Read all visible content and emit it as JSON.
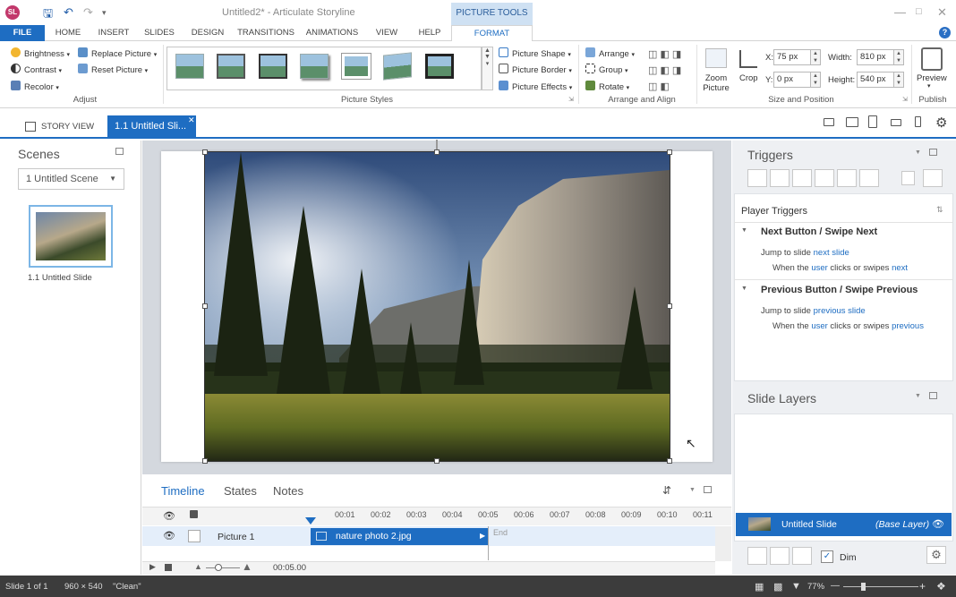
{
  "app": {
    "logo": "SL",
    "title": "Untitled2* - Articulate Storyline",
    "context_tab_header": "PICTURE TOOLS"
  },
  "ribbon_tabs": [
    "FILE",
    "HOME",
    "INSERT",
    "SLIDES",
    "DESIGN",
    "TRANSITIONS",
    "ANIMATIONS",
    "VIEW",
    "HELP",
    "FORMAT"
  ],
  "ribbon": {
    "adjust": {
      "label": "Adjust",
      "brightness": "Brightness",
      "contrast": "Contrast",
      "recolor": "Recolor",
      "replace_picture": "Replace Picture",
      "reset_picture": "Reset Picture"
    },
    "picture_styles": {
      "label": "Picture Styles",
      "shape": "Picture Shape",
      "border": "Picture Border",
      "effects": "Picture Effects"
    },
    "arrange": {
      "label": "Arrange and Align",
      "arrange": "Arrange",
      "group": "Group",
      "rotate": "Rotate"
    },
    "zoom_picture": "Zoom Picture",
    "crop": "Crop",
    "size_position": {
      "label": "Size and Position",
      "x_label": "X:",
      "x_value": "75 px",
      "y_label": "Y:",
      "y_value": "0 px",
      "width_label": "Width:",
      "width_value": "810 px",
      "height_label": "Height:",
      "height_value": "540 px"
    },
    "publish": {
      "label": "Publish",
      "preview": "Preview"
    }
  },
  "view_bar": {
    "story_view": "STORY VIEW",
    "slide_tab": "1.1 Untitled Sli...",
    "close": "✕"
  },
  "scenes": {
    "title": "Scenes",
    "selected_scene": "1 Untitled Scene",
    "slide_label": "1.1 Untitled Slide"
  },
  "timeline": {
    "tabs": [
      "Timeline",
      "States",
      "Notes"
    ],
    "ticks": [
      "00:01",
      "00:02",
      "00:03",
      "00:04",
      "00:05",
      "00:06",
      "00:07",
      "00:08",
      "00:09",
      "00:10",
      "00:11"
    ],
    "row_name": "Picture 1",
    "bar_label": "nature photo 2.jpg",
    "end_label": "End",
    "duration": "00:05.00"
  },
  "triggers": {
    "title": "Triggers",
    "section": "Player Triggers",
    "items": [
      {
        "title": "Next Button / Swipe Next",
        "action_text": "Jump to slide ",
        "action_link": "next slide",
        "when_prefix": "When the ",
        "when_user": "user",
        "when_middle": " clicks or swipes ",
        "when_link": "next"
      },
      {
        "title": "Previous Button / Swipe Previous",
        "action_text": "Jump to slide ",
        "action_link": "previous slide",
        "when_prefix": "When the ",
        "when_user": "user",
        "when_middle": " clicks or swipes ",
        "when_link": "previous"
      }
    ]
  },
  "layers": {
    "title": "Slide Layers",
    "base_name": "Untitled Slide",
    "base_tag": "(Base Layer)",
    "dim": "Dim"
  },
  "status": {
    "slide": "Slide 1 of 1",
    "size": "960 × 540",
    "theme": "\"Clean\"",
    "zoom": "77%"
  },
  "colors": {
    "accent": "#1e6dc2",
    "status_bg": "#3c3c3c"
  }
}
